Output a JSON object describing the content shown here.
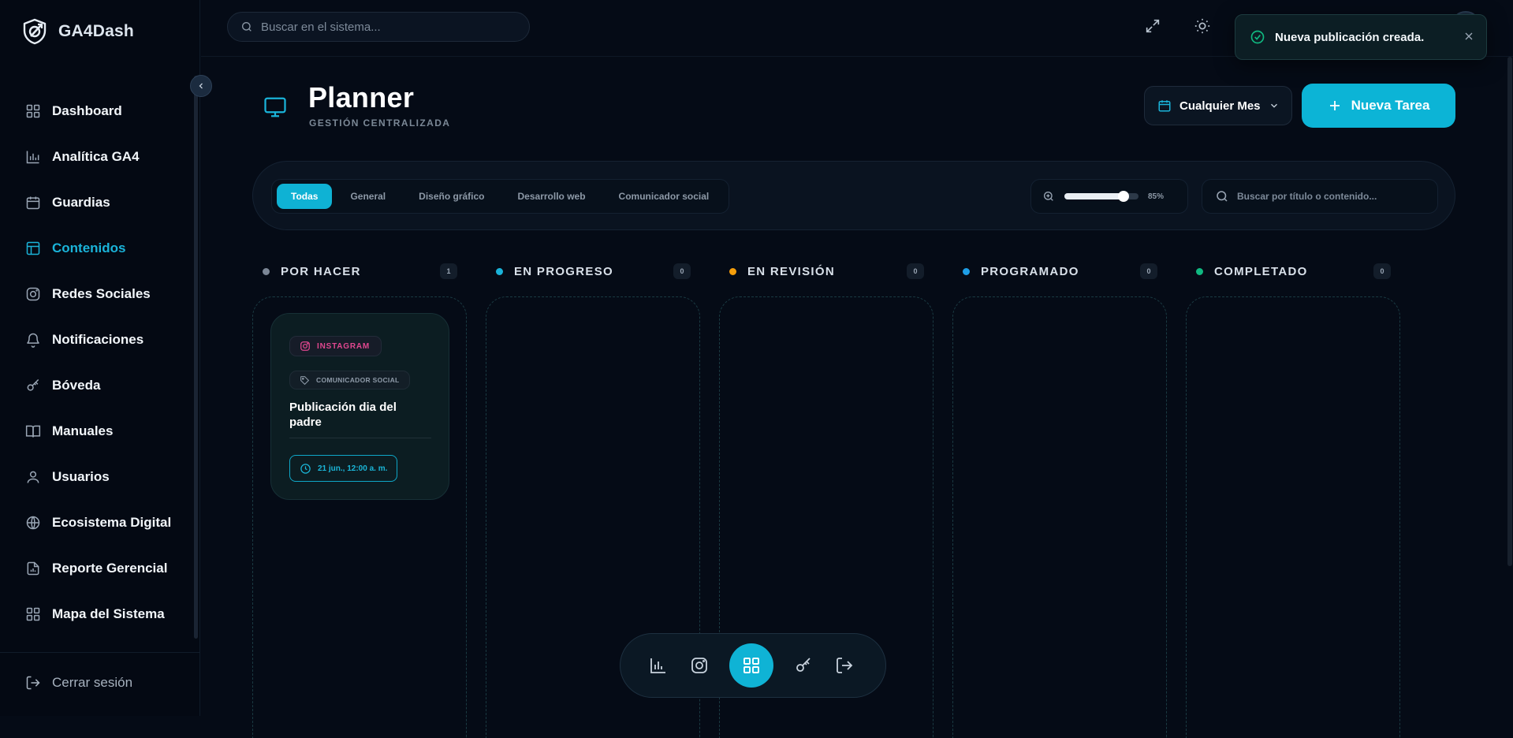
{
  "app": {
    "name": "GA4Dash"
  },
  "sidebar": {
    "items": [
      {
        "label": "Dashboard"
      },
      {
        "label": "Analítica GA4"
      },
      {
        "label": "Guardias"
      },
      {
        "label": "Contenidos",
        "active": true
      },
      {
        "label": "Redes Sociales"
      },
      {
        "label": "Notificaciones"
      },
      {
        "label": "Bóveda"
      },
      {
        "label": "Manuales"
      },
      {
        "label": "Usuarios"
      },
      {
        "label": "Ecosistema Digital"
      },
      {
        "label": "Reporte Gerencial"
      },
      {
        "label": "Mapa del Sistema"
      }
    ],
    "logout_label": "Cerrar sesión"
  },
  "header": {
    "search_placeholder": "Buscar en el sistema...",
    "search_value": ""
  },
  "toast": {
    "message": "Nueva publicación creada."
  },
  "page": {
    "title": "Planner",
    "subtitle": "GESTIÓN CENTRALIZADA",
    "month_filter": "Cualquier Mes",
    "new_task_label": "Nueva Tarea"
  },
  "filters": {
    "tabs": [
      {
        "label": "Todas",
        "active": true
      },
      {
        "label": "General"
      },
      {
        "label": "Diseño gráfico"
      },
      {
        "label": "Desarrollo web"
      },
      {
        "label": "Comunicador social"
      }
    ],
    "zoom_percent": 85,
    "zoom_label": "85%",
    "search_placeholder": "Buscar por título o contenido..."
  },
  "columns": [
    {
      "title": "POR HACER",
      "count": "1",
      "color": "#7c8796"
    },
    {
      "title": "EN PROGRESO",
      "count": "0",
      "color": "#1ab3d9"
    },
    {
      "title": "EN REVISIÓN",
      "count": "0",
      "color": "#f59e0b"
    },
    {
      "title": "PROGRAMADO",
      "count": "0",
      "color": "#1e9ee6"
    },
    {
      "title": "COMPLETADO",
      "count": "0",
      "color": "#10b981"
    }
  ],
  "card": {
    "platform": "INSTAGRAM",
    "category": "COMUNICADOR SOCIAL",
    "title": "Publicación dia del padre",
    "date": "21 jun., 12:00 a. m."
  },
  "colors": {
    "accent": "#0fb3d5",
    "background": "#050b16",
    "instagram": "#e0478f"
  }
}
